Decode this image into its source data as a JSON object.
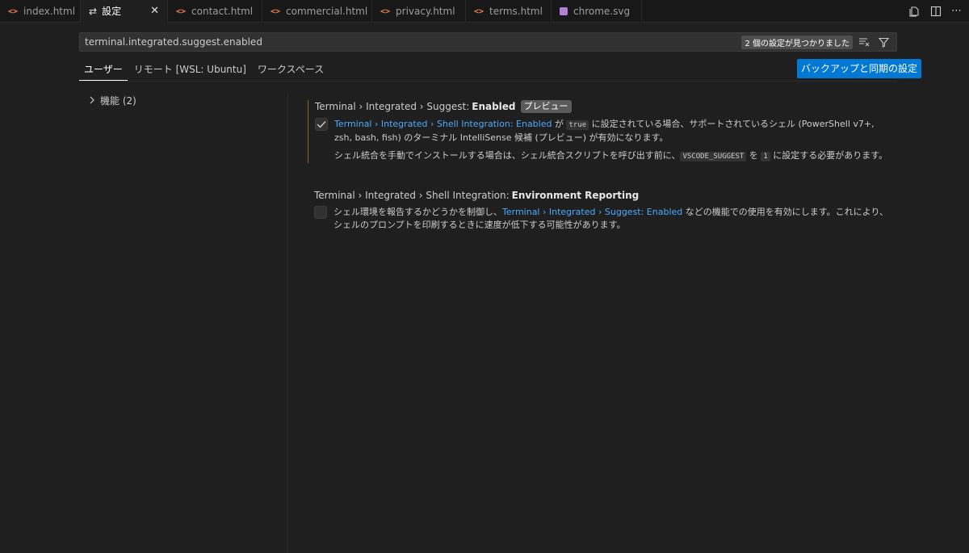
{
  "tabs": [
    {
      "label": "index.html",
      "icon": "html-file-icon"
    },
    {
      "label": "設定",
      "icon": "settings-icon",
      "active": true
    },
    {
      "label": "contact.html",
      "icon": "html-file-icon"
    },
    {
      "label": "commercial.html",
      "icon": "html-file-icon"
    },
    {
      "label": "privacy.html",
      "icon": "html-file-icon"
    },
    {
      "label": "terms.html",
      "icon": "html-file-icon"
    },
    {
      "label": "chrome.svg",
      "icon": "svg-file-icon"
    }
  ],
  "search": {
    "value": "terminal.integrated.suggest.enabled",
    "result_count": "2 個の設定が見つかりました"
  },
  "scopes": [
    "ユーザー",
    "リモート [WSL: Ubuntu]",
    "ワークスペース"
  ],
  "sync_button": "バックアップと同期の設定",
  "toc": {
    "label": "機能 (2)"
  },
  "settings": [
    {
      "category": "Terminal › Integrated › Suggest: ",
      "name": "Enabled",
      "badge": "プレビュー",
      "checked": true,
      "desc_link": "Terminal › Integrated › Shell Integration: Enabled",
      "desc_mid1": " が ",
      "desc_code1": "true",
      "desc_rest": " に設定されている場合、サポートされているシェル (PowerShell v7+, zsh, bash, fish) のターミナル IntelliSense 候補 (プレビュー) が有効になります。",
      "desc2_a": "シェル統合を手動でインストールする場合は、シェル統合スクリプトを呼び出す前に、",
      "desc2_code1": "VSCODE_SUGGEST",
      "desc2_b": " を ",
      "desc2_code2": "1",
      "desc2_c": " に設定する必要があります。"
    },
    {
      "category": "Terminal › Integrated › Shell Integration: ",
      "name": "Environment Reporting",
      "checked": false,
      "desc_a": "シェル環境を報告するかどうかを制御し、",
      "desc_link": "Terminal › Integrated › Suggest: Enabled",
      "desc_b": " などの機能での使用を有効にします。これにより、シェルのプロンプトを印刷するときに速度が低下する可能性があります。"
    }
  ]
}
